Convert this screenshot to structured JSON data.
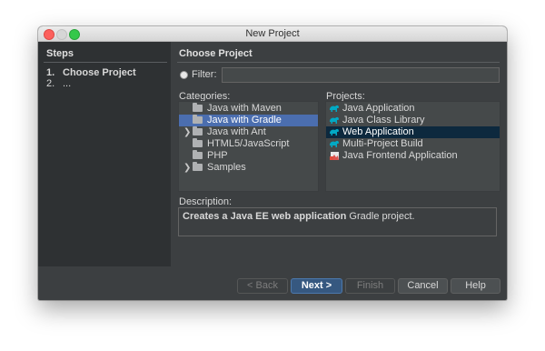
{
  "window": {
    "title": "New Project"
  },
  "steps": {
    "heading": "Steps",
    "items": [
      {
        "num": "1.",
        "label": "Choose Project"
      },
      {
        "num": "2.",
        "label": "..."
      }
    ]
  },
  "main": {
    "heading": "Choose Project",
    "filter": {
      "label": "Filter:",
      "value": "",
      "placeholder": ""
    },
    "categories": {
      "label": "Categories:",
      "items": [
        {
          "label": "Java with Maven",
          "expandable": false,
          "selected": false
        },
        {
          "label": "Java with Gradle",
          "expandable": false,
          "selected": true
        },
        {
          "label": "Java with Ant",
          "expandable": true,
          "selected": false
        },
        {
          "label": "HTML5/JavaScript",
          "expandable": false,
          "selected": false
        },
        {
          "label": "PHP",
          "expandable": false,
          "selected": false
        },
        {
          "label": "Samples",
          "expandable": true,
          "selected": false
        }
      ]
    },
    "projects": {
      "label": "Projects:",
      "items": [
        {
          "label": "Java Application",
          "icon": "gradle-elephant-icon",
          "selected": false
        },
        {
          "label": "Java Class Library",
          "icon": "gradle-elephant-icon",
          "selected": false
        },
        {
          "label": "Web Application",
          "icon": "gradle-elephant-icon",
          "selected": true
        },
        {
          "label": "Multi-Project Build",
          "icon": "gradle-elephant-icon",
          "selected": false
        },
        {
          "label": "Java Frontend Application",
          "icon": "frontend-app-icon",
          "selected": false
        }
      ]
    },
    "description": {
      "label": "Description:",
      "bold_text": "Creates a Java EE web application",
      "rest_text": " Gradle project."
    }
  },
  "buttons": {
    "back": "< Back",
    "next": "Next >",
    "finish": "Finish",
    "cancel": "Cancel",
    "help": "Help"
  },
  "colors": {
    "window_bg": "#3c3f41",
    "steps_bg": "#2e3133",
    "list_bg": "#45494a",
    "category_selection": "#4b6eaf",
    "project_selection": "#0d293e",
    "primary_button": "#365880",
    "gradle_icon": "#02a9c4"
  }
}
